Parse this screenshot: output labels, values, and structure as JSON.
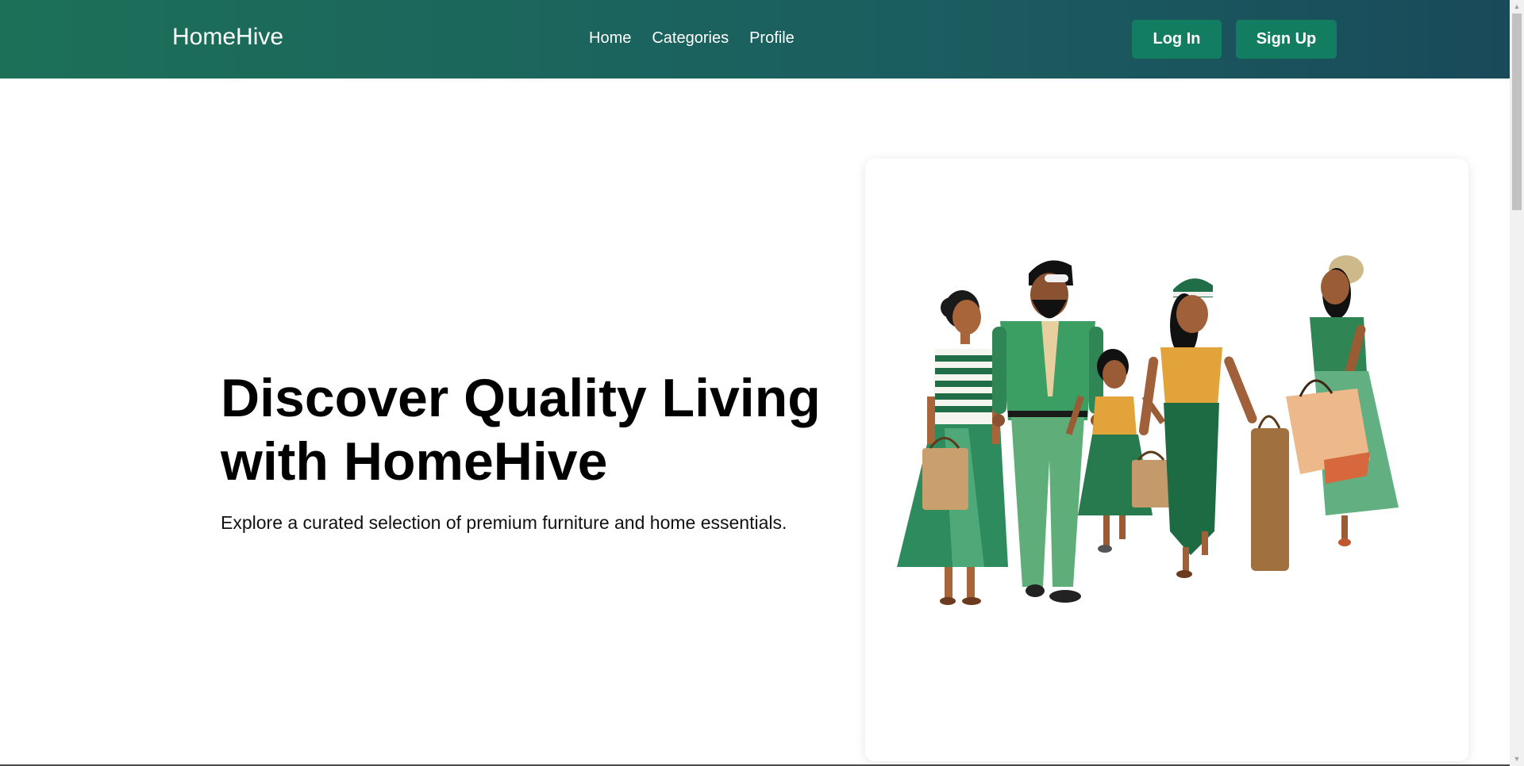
{
  "navbar": {
    "brand": "HomeHive",
    "links": [
      {
        "label": "Home"
      },
      {
        "label": "Categories"
      },
      {
        "label": "Profile"
      }
    ],
    "login_label": "Log In",
    "signup_label": "Sign Up"
  },
  "hero": {
    "title": "Discover Quality Living with HomeHive",
    "subtitle": "Explore a curated selection of premium furniture and home essentials."
  },
  "colors": {
    "nav_gradient_start": "#1c7058",
    "nav_gradient_end": "#194a5a",
    "button": "#137d61"
  },
  "icons": {
    "scroll_up": "chevron-up-icon",
    "scroll_down": "chevron-down-icon"
  }
}
